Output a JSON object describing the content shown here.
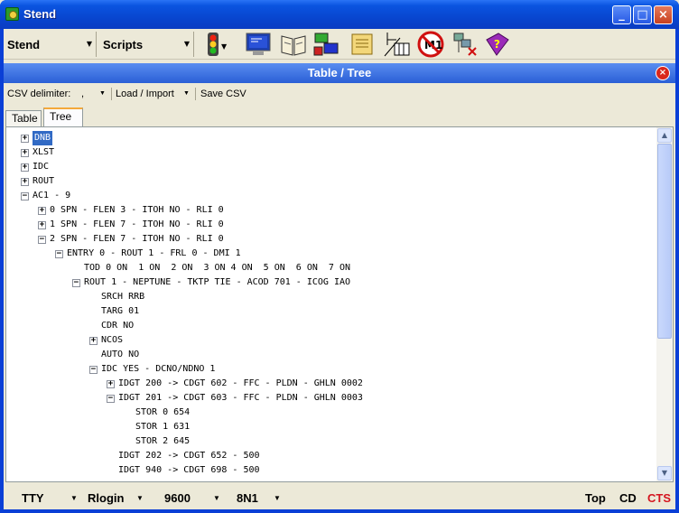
{
  "window": {
    "title": "Stend"
  },
  "toolbar": {
    "stend_label": "Stend",
    "scripts_label": "Scripts",
    "icons": [
      "traffic-light-icon",
      "monitor-icon",
      "book-icon",
      "network-tools-icon",
      "scroll-icon",
      "grid-tool-icon",
      "no-m1-icon",
      "disconnect-network-icon",
      "help-book-icon"
    ]
  },
  "panel": {
    "title": "Table / Tree"
  },
  "csv": {
    "delimiter_label": "CSV delimiter:",
    "delimiter_value": ",",
    "load_label": "Load / Import",
    "save_label": "Save CSV"
  },
  "tabs": [
    {
      "label": "Table"
    },
    {
      "label": "Tree"
    }
  ],
  "tree": {
    "rows": [
      {
        "text": "DNB",
        "level": 0,
        "toggle": "+",
        "selected": true
      },
      {
        "text": "XLST",
        "level": 0,
        "toggle": "+"
      },
      {
        "text": "IDC",
        "level": 0,
        "toggle": "+"
      },
      {
        "text": "ROUT",
        "level": 0,
        "toggle": "+"
      },
      {
        "text": "AC1 - 9",
        "level": 0,
        "toggle": "-"
      },
      {
        "text": "0 SPN - FLEN 3 - ITOH NO - RLI 0",
        "level": 1,
        "toggle": "+"
      },
      {
        "text": "1 SPN - FLEN 7 - ITOH NO - RLI 0",
        "level": 1,
        "toggle": "+"
      },
      {
        "text": "2 SPN - FLEN 7 - ITOH NO - RLI 0",
        "level": 1,
        "toggle": "-"
      },
      {
        "text": "ENTRY 0 - ROUT 1 - FRL 0 - DMI 1",
        "level": 2,
        "toggle": "-"
      },
      {
        "text": "TOD 0 ON  1 ON  2 ON  3 ON 4 ON  5 ON  6 ON  7 ON",
        "level": 3,
        "toggle": ""
      },
      {
        "text": "ROUT 1 - NEPTUNE - TKTP TIE - ACOD 701 - ICOG IAO",
        "level": 3,
        "toggle": "-"
      },
      {
        "text": "SRCH RRB",
        "level": 4,
        "toggle": ""
      },
      {
        "text": "TARG 01",
        "level": 4,
        "toggle": ""
      },
      {
        "text": "CDR NO",
        "level": 4,
        "toggle": ""
      },
      {
        "text": "NCOS",
        "level": 4,
        "toggle": "+"
      },
      {
        "text": "AUTO NO",
        "level": 4,
        "toggle": ""
      },
      {
        "text": "IDC YES - DCNO/NDNO 1",
        "level": 4,
        "toggle": "-"
      },
      {
        "text": "IDGT 200 -> CDGT 602 - FFC - PLDN - GHLN 0002",
        "level": 5,
        "toggle": "+"
      },
      {
        "text": "IDGT 201 -> CDGT 603 - FFC - PLDN - GHLN 0003",
        "level": 5,
        "toggle": "-"
      },
      {
        "text": "STOR 0 654",
        "level": 6,
        "toggle": ""
      },
      {
        "text": "STOR 1 631",
        "level": 6,
        "toggle": ""
      },
      {
        "text": "STOR 2 645",
        "level": 6,
        "toggle": ""
      },
      {
        "text": "IDGT 202 -> CDGT 652 - 500",
        "level": 5,
        "toggle": ""
      },
      {
        "text": "IDGT 940 -> CDGT 698 - 500",
        "level": 5,
        "toggle": ""
      }
    ]
  },
  "statusbar": {
    "port": "TTY",
    "protocol": "Rlogin",
    "baud": "9600",
    "format": "8N1",
    "top": "Top",
    "cd": "CD",
    "cts": "CTS"
  },
  "colors": {
    "title_bar": "#0a54e0",
    "selection": "#316ac5",
    "cts": "#d4141e",
    "tab_accent": "#f4a93a"
  }
}
